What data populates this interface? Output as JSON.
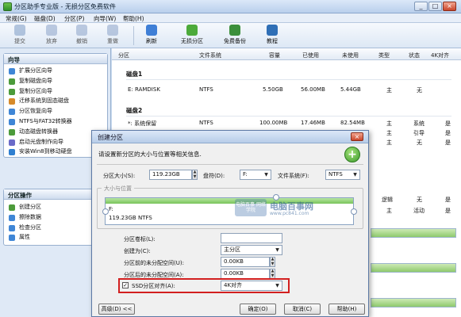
{
  "window": {
    "title": "分区助手专业版 - 无损分区免费软件",
    "controls": [
      "_",
      "□",
      "×"
    ]
  },
  "menu": [
    "常规(G)",
    "磁盘(D)",
    "分区(P)",
    "向导(W)",
    "帮助(H)"
  ],
  "toolbar": [
    {
      "label": "提交",
      "icon": "commit-icon",
      "color": "#7c9ac4"
    },
    {
      "label": "放弃",
      "icon": "discard-icon",
      "color": "#8aa2c8"
    },
    {
      "label": "撤销",
      "icon": "undo-icon",
      "color": "#8aa2c8"
    },
    {
      "label": "重做",
      "icon": "redo-icon",
      "color": "#8aa2c8"
    },
    {
      "label": "刷新",
      "icon": "refresh-icon",
      "color": "#3f7fd6"
    },
    {
      "label": "无损分区",
      "icon": "partition-icon",
      "color": "#4caa3a"
    },
    {
      "label": "免费备份",
      "icon": "backup-icon",
      "color": "#3b8f3b"
    },
    {
      "label": "教程",
      "icon": "tutorial-icon",
      "color": "#2f6fb6"
    }
  ],
  "wizard_panel": {
    "title": "向导",
    "items": [
      {
        "label": "扩展分区向导",
        "color": "#3f86d6"
      },
      {
        "label": "复制磁盘向导",
        "color": "#4c9b3b"
      },
      {
        "label": "复制分区向导",
        "color": "#4c9b3b"
      },
      {
        "label": "迁移系统到固态磁盘",
        "color": "#d68a2a"
      },
      {
        "label": "分区恢复向导",
        "color": "#3f86d6"
      },
      {
        "label": "NTFS与FAT32转换器",
        "color": "#3f86d6"
      },
      {
        "label": "动态磁盘转换器",
        "color": "#4c9b3b"
      },
      {
        "label": "启动光盘制作向导",
        "color": "#6a6ac8"
      },
      {
        "label": "安装Win8到移动硬盘",
        "color": "#2f7fd0"
      }
    ]
  },
  "partition_ops_panel": {
    "title": "分区操作",
    "items": [
      {
        "label": "创建分区",
        "color": "#4c9b3b"
      },
      {
        "label": "擦除数据",
        "color": "#3f86d6"
      },
      {
        "label": "检查分区",
        "color": "#3f86d6"
      },
      {
        "label": "属性",
        "color": "#3f86d6"
      }
    ]
  },
  "list_columns": [
    "分区",
    "文件系统",
    "容量",
    "已使用",
    "未使用",
    "类型",
    "状态",
    "4K对齐"
  ],
  "disks": {
    "disk1_header": "磁盘1",
    "disk1_row": {
      "partition": "E: RAMDISK",
      "fs": "NTFS",
      "capacity": "5.50GB",
      "used": "56.00MB",
      "free": "5.44GB",
      "type": "主",
      "status": "无"
    },
    "disk2_header": "磁盘2",
    "disk2_rows": [
      {
        "partition": "*: 系统保留",
        "fs": "NTFS",
        "capacity": "100.00MB",
        "used": "17.46MB",
        "free": "82.54MB",
        "type": "主",
        "status": "系统",
        "aligned": "是"
      },
      {
        "type": "主",
        "status": "引导",
        "aligned": "是"
      },
      {
        "type": "主",
        "status": "无",
        "aligned": "是"
      },
      {
        "type": "逻辑",
        "status": "无",
        "aligned": "是"
      },
      {
        "type": "主",
        "status": "活动",
        "aligned": "是"
      }
    ]
  },
  "dialog": {
    "title": "创建分区",
    "description": "请设置新分区的大小与位置等相关信息.",
    "size_label": "分区大小(S):",
    "size_value": "119.23GB",
    "drive_label": "盘符(D):",
    "drive_value": "F:",
    "fs_label": "文件系统(F):",
    "fs_value": "NTFS",
    "group_title": "大小与位置",
    "partition_name": "F:",
    "partition_info": "119.23GB NTFS",
    "label_field": "分区卷标(L):",
    "label_value": "",
    "create_as_label": "创建为(C):",
    "create_as_value": "主分区",
    "before_label": "分区前的未分配空间(U):",
    "before_value": "0.00KB",
    "after_label": "分区后的未分配空间(A):",
    "after_value": "0.00KB",
    "ssd_label": "SSD分区对齐(A):",
    "ssd_value": "4K对齐",
    "ssd_checked": "✓",
    "advanced_btn": "高级(D) <<",
    "ok_btn": "确定(O)",
    "cancel_btn": "取消(C)",
    "help_btn": "帮助(H)"
  },
  "watermark": {
    "logo": "电脑百事 网络学院",
    "text": "电脑百事网",
    "url": "www.pc841.com"
  }
}
